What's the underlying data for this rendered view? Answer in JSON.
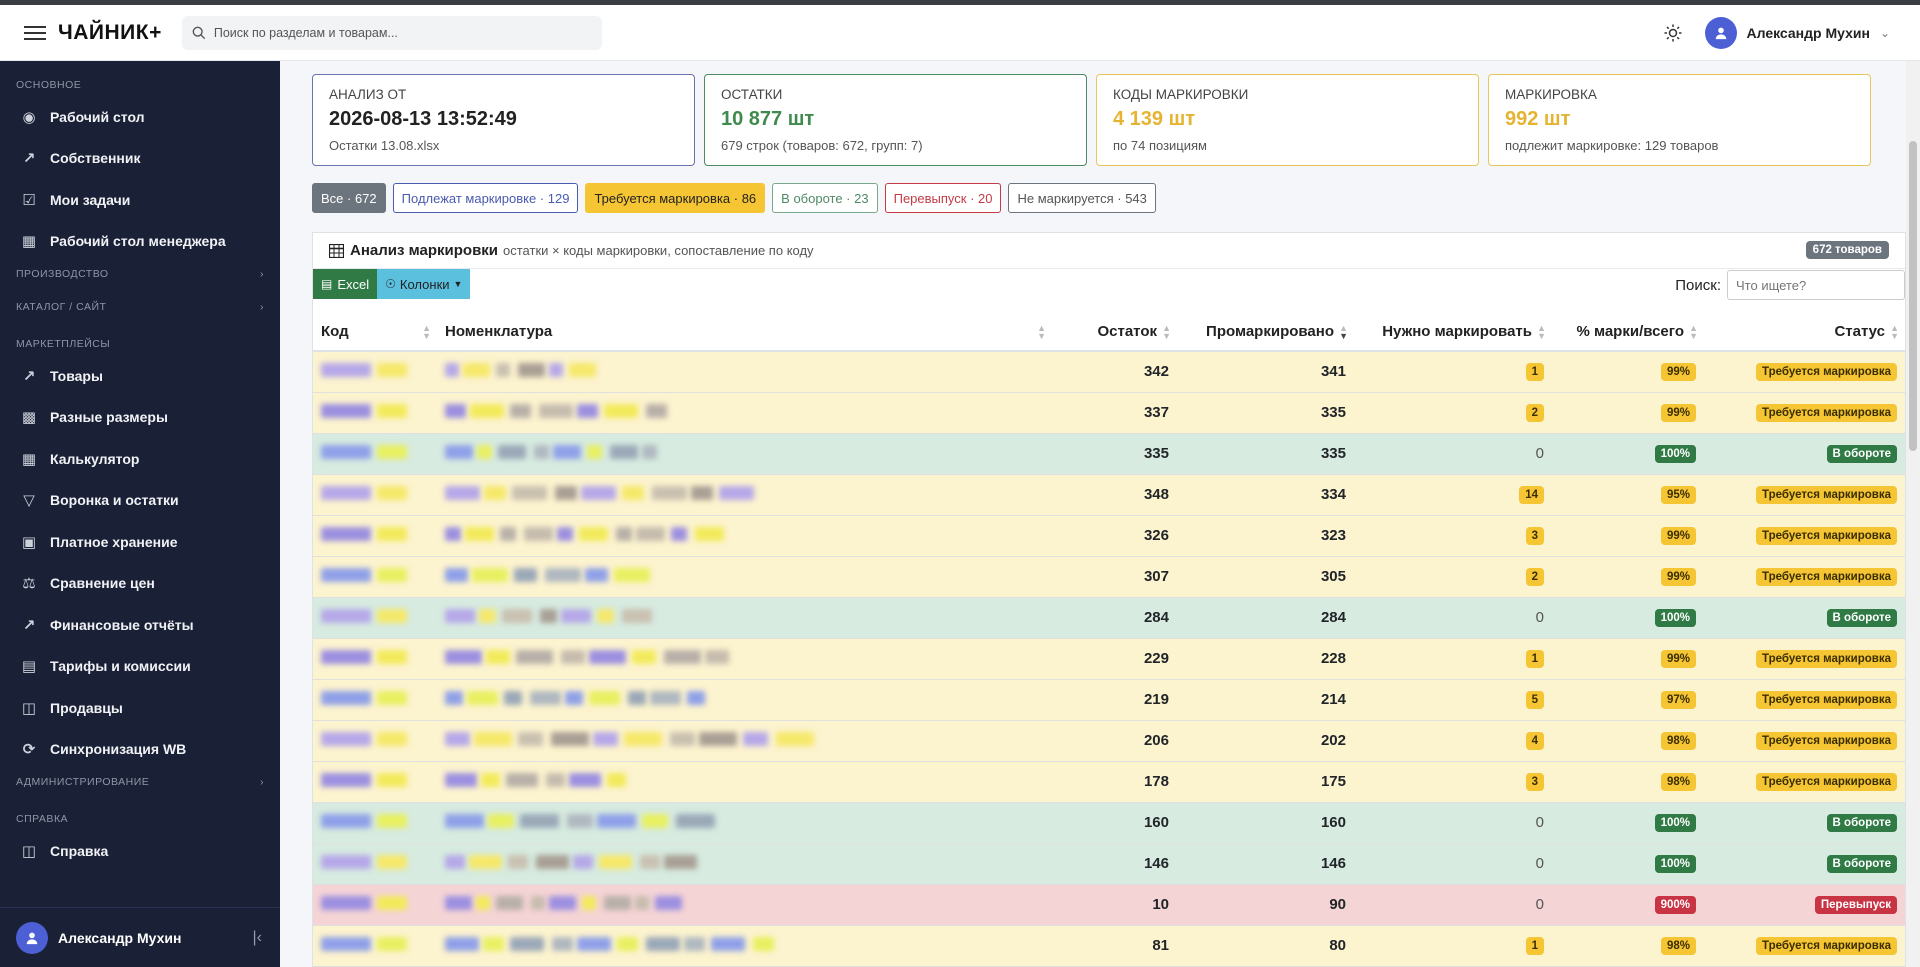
{
  "header": {
    "brand": "ЧАЙНИК+",
    "search_placeholder": "Поиск по разделам и товарам...",
    "user_name": "Александр Мухин"
  },
  "sidebar": {
    "sections": [
      {
        "title": "ОСНОВНОЕ",
        "items": [
          {
            "label": "Рабочий стол",
            "icon": "palette-icon"
          },
          {
            "label": "Собственник",
            "icon": "chart-line-icon"
          },
          {
            "label": "Мои задачи",
            "icon": "checkbox-icon"
          },
          {
            "label": "Рабочий стол менеджера",
            "icon": "building-icon"
          }
        ]
      },
      {
        "title": "ПРОИЗВОДСТВО",
        "items": []
      },
      {
        "title": "КАТАЛОГ / САЙТ",
        "items": []
      },
      {
        "title": "МАРКЕТПЛЕЙСЫ",
        "items": [
          {
            "label": "Товары",
            "icon": "chart-line-icon"
          },
          {
            "label": "Разные размеры",
            "icon": "grid-icon"
          },
          {
            "label": "Калькулятор",
            "icon": "calculator-icon"
          },
          {
            "label": "Воронка и остатки",
            "icon": "funnel-icon"
          },
          {
            "label": "Платное хранение",
            "icon": "boxes-icon"
          },
          {
            "label": "Сравнение цен",
            "icon": "scales-icon"
          },
          {
            "label": "Финансовые отчёты",
            "icon": "chart-line-icon"
          },
          {
            "label": "Тарифы и комиссии",
            "icon": "wallet-icon"
          },
          {
            "label": "Продавцы",
            "icon": "book-icon"
          },
          {
            "label": "Синхронизация WB",
            "icon": "sync-icon"
          }
        ]
      },
      {
        "title": "АДМИНИСТРИРОВАНИЕ",
        "items": []
      },
      {
        "title": "СПРАВКА",
        "items": [
          {
            "label": "Справка",
            "icon": "book-open-icon"
          }
        ]
      }
    ],
    "footer_name": "Александр Мухин"
  },
  "cards": [
    {
      "label": "АНАЛИЗ ОТ",
      "value": "2026-08-13 13:52:49",
      "sub": "Остатки 13.08.xlsx",
      "border": "#6a73b0",
      "value_color": "#222222"
    },
    {
      "label": "ОСТАТКИ",
      "value": "10 877 шт",
      "sub": "679 строк (товаров: 672, групп: 7)",
      "border": "#4f8a66",
      "value_color": "#3f8a4d"
    },
    {
      "label": "КОДЫ МАРКИРОВКИ",
      "value": "4 139 шт",
      "sub": "по 74 позициям",
      "border": "#e8c65a",
      "value_color": "#e5b432"
    },
    {
      "label": "МАРКИРОВКА",
      "value": "992 шт",
      "sub": "подлежит маркировке: 129 товаров",
      "border": "#e8c65a",
      "value_color": "#e5b432"
    }
  ],
  "filters": [
    {
      "label": "Все · 672",
      "bg": "#6c757d",
      "fg": "#ffffff",
      "border": "#6c757d"
    },
    {
      "label": "Подлежат маркировке · 129",
      "bg": "#ffffff",
      "fg": "#4a5bb0",
      "border": "#4a5bb0"
    },
    {
      "label": "Требуется маркировка · 86",
      "bg": "#f5c533",
      "fg": "#222222",
      "border": "#f5c533"
    },
    {
      "label": "В обороте · 23",
      "bg": "#ffffff",
      "fg": "#4f8a66",
      "border": "#7aa88a"
    },
    {
      "label": "Перевыпуск · 20",
      "bg": "#ffffff",
      "fg": "#c43b45",
      "border": "#c43b45"
    },
    {
      "label": "Не маркируется · 543",
      "bg": "#ffffff",
      "fg": "#555555",
      "border": "#6c757d"
    }
  ],
  "panel": {
    "title": "Анализ маркировки",
    "subtitle": "остатки × коды маркировки, сопоставление по коду",
    "count": "672 товаров",
    "excel_label": "Excel",
    "columns_label": "Колонки",
    "search_label": "Поиск:",
    "search_placeholder": "Что ищете?"
  },
  "table": {
    "headers": [
      "Код",
      "Номенклатура",
      "Остаток",
      "Промаркировано",
      "Нужно маркировать",
      "% марки/всего",
      "Статус"
    ],
    "rows": [
      {
        "kind": "warn",
        "stock": "342",
        "marked": "341",
        "need": "1",
        "pct": "99%",
        "status": "Требуется маркировка"
      },
      {
        "kind": "warn",
        "stock": "337",
        "marked": "335",
        "need": "2",
        "pct": "99%",
        "status": "Требуется маркировка"
      },
      {
        "kind": "ok",
        "stock": "335",
        "marked": "335",
        "need": "0",
        "pct": "100%",
        "status": "В обороте"
      },
      {
        "kind": "warn",
        "stock": "348",
        "marked": "334",
        "need": "14",
        "pct": "95%",
        "status": "Требуется маркировка"
      },
      {
        "kind": "warn",
        "stock": "326",
        "marked": "323",
        "need": "3",
        "pct": "99%",
        "status": "Требуется маркировка"
      },
      {
        "kind": "warn",
        "stock": "307",
        "marked": "305",
        "need": "2",
        "pct": "99%",
        "status": "Требуется маркировка"
      },
      {
        "kind": "ok",
        "stock": "284",
        "marked": "284",
        "need": "0",
        "pct": "100%",
        "status": "В обороте"
      },
      {
        "kind": "warn",
        "stock": "229",
        "marked": "228",
        "need": "1",
        "pct": "99%",
        "status": "Требуется маркировка"
      },
      {
        "kind": "warn",
        "stock": "219",
        "marked": "214",
        "need": "5",
        "pct": "97%",
        "status": "Требуется маркировка"
      },
      {
        "kind": "warn",
        "stock": "206",
        "marked": "202",
        "need": "4",
        "pct": "98%",
        "status": "Требуется маркировка"
      },
      {
        "kind": "warn",
        "stock": "178",
        "marked": "175",
        "need": "3",
        "pct": "98%",
        "status": "Требуется маркировка"
      },
      {
        "kind": "ok",
        "stock": "160",
        "marked": "160",
        "need": "0",
        "pct": "100%",
        "status": "В обороте"
      },
      {
        "kind": "ok",
        "stock": "146",
        "marked": "146",
        "need": "0",
        "pct": "100%",
        "status": "В обороте"
      },
      {
        "kind": "danger",
        "stock": "10",
        "marked": "90",
        "need": "0",
        "pct": "900%",
        "status": "Перевыпуск"
      },
      {
        "kind": "warn",
        "stock": "81",
        "marked": "80",
        "need": "1",
        "pct": "98%",
        "status": "Требуется маркировка"
      }
    ]
  },
  "icons": {
    "theme": "sun-icon",
    "scroll_top": "arrow-up-icon",
    "menu": "hamburger-icon"
  }
}
